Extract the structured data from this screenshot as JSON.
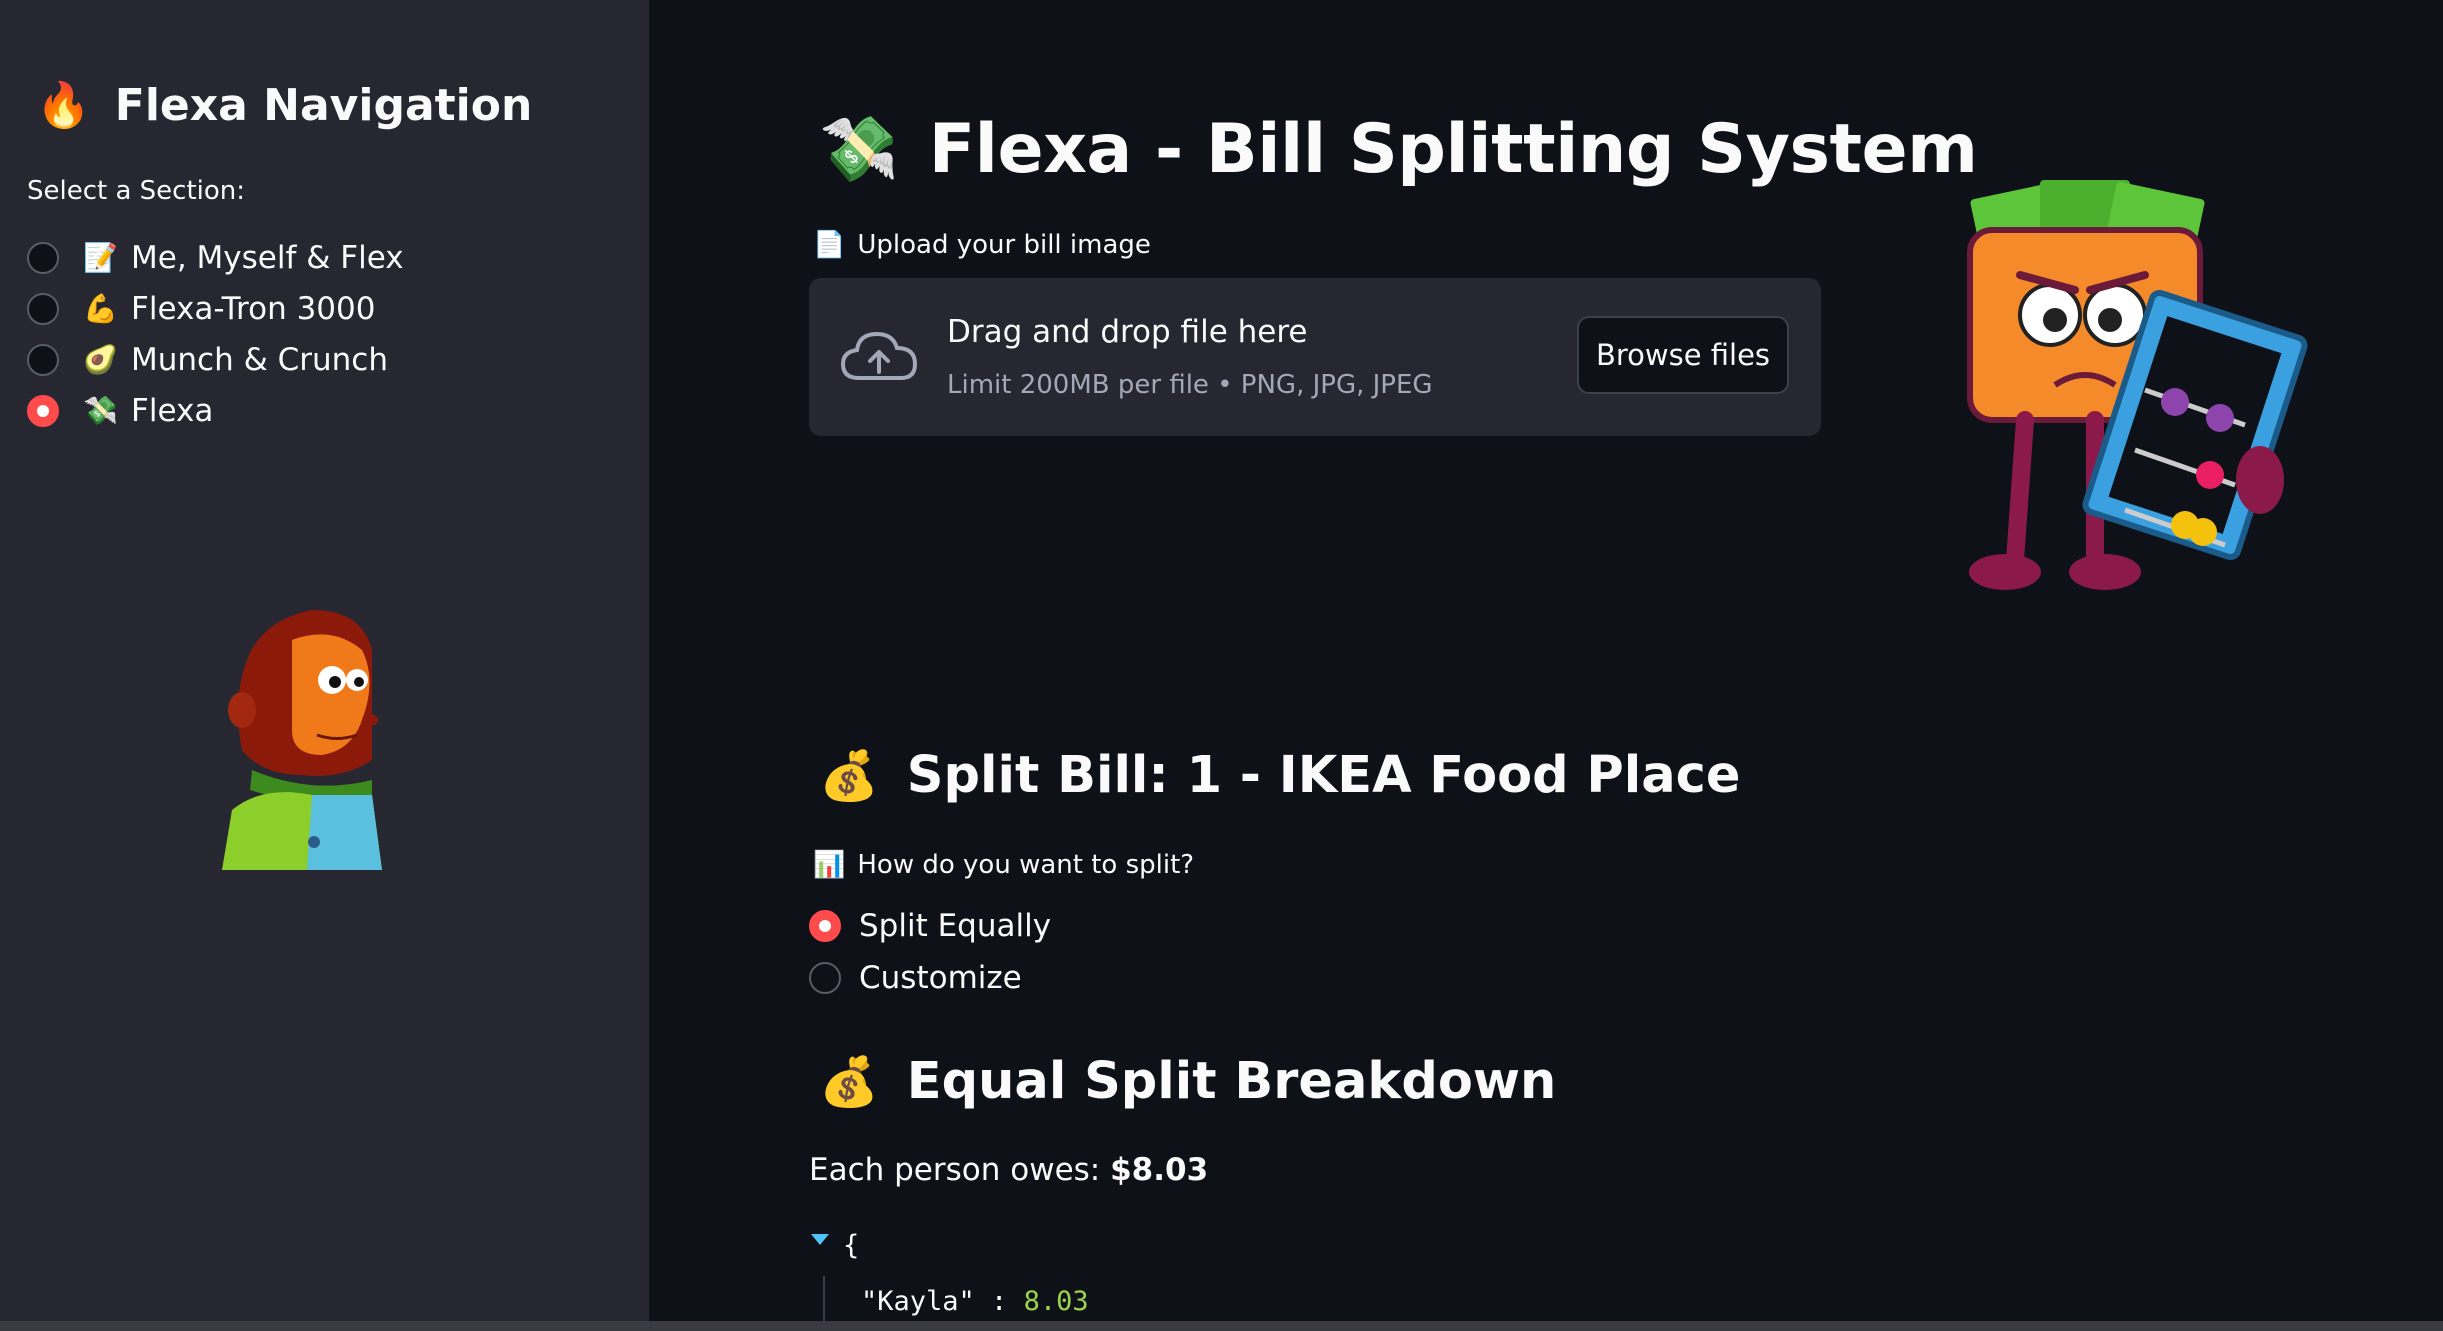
{
  "sidebar": {
    "title": "Flexa Navigation",
    "title_icon": "🔥",
    "section_label": "Select a Section:",
    "items": [
      {
        "icon": "📝",
        "label": "Me, Myself & Flex",
        "selected": false
      },
      {
        "icon": "💪",
        "label": "Flexa-Tron 3000",
        "selected": false
      },
      {
        "icon": "🥑",
        "label": "Munch & Crunch",
        "selected": false
      },
      {
        "icon": "💸",
        "label": "Flexa",
        "selected": true
      }
    ]
  },
  "main": {
    "title": "Flexa - Bill Splitting System",
    "title_icon": "💸",
    "upload": {
      "icon": "📄",
      "label": "Upload your bill image",
      "drop_text": "Drag and drop file here",
      "limit_text": "Limit 200MB per file • PNG, JPG, JPEG",
      "browse_label": "Browse files"
    },
    "split_heading": {
      "icon": "💰",
      "text": "Split Bill: 1 - IKEA Food Place"
    },
    "split_question": {
      "icon": "📊",
      "text": "How do you want to split?"
    },
    "split_options": [
      {
        "label": "Split Equally",
        "selected": true
      },
      {
        "label": "Customize",
        "selected": false
      }
    ],
    "breakdown_heading": {
      "icon": "💰",
      "text": "Equal Split Breakdown"
    },
    "owes_label": "Each person owes: ",
    "owes_amount": "$8.03",
    "json": {
      "open_brace": "{",
      "key": "\"Kayla\"",
      "sep": " : ",
      "value": "8.03"
    }
  },
  "colors": {
    "accent": "#ff4b4b",
    "sidebar_bg": "#262730",
    "main_bg": "#0e1117",
    "json_value": "#9bd34f"
  }
}
